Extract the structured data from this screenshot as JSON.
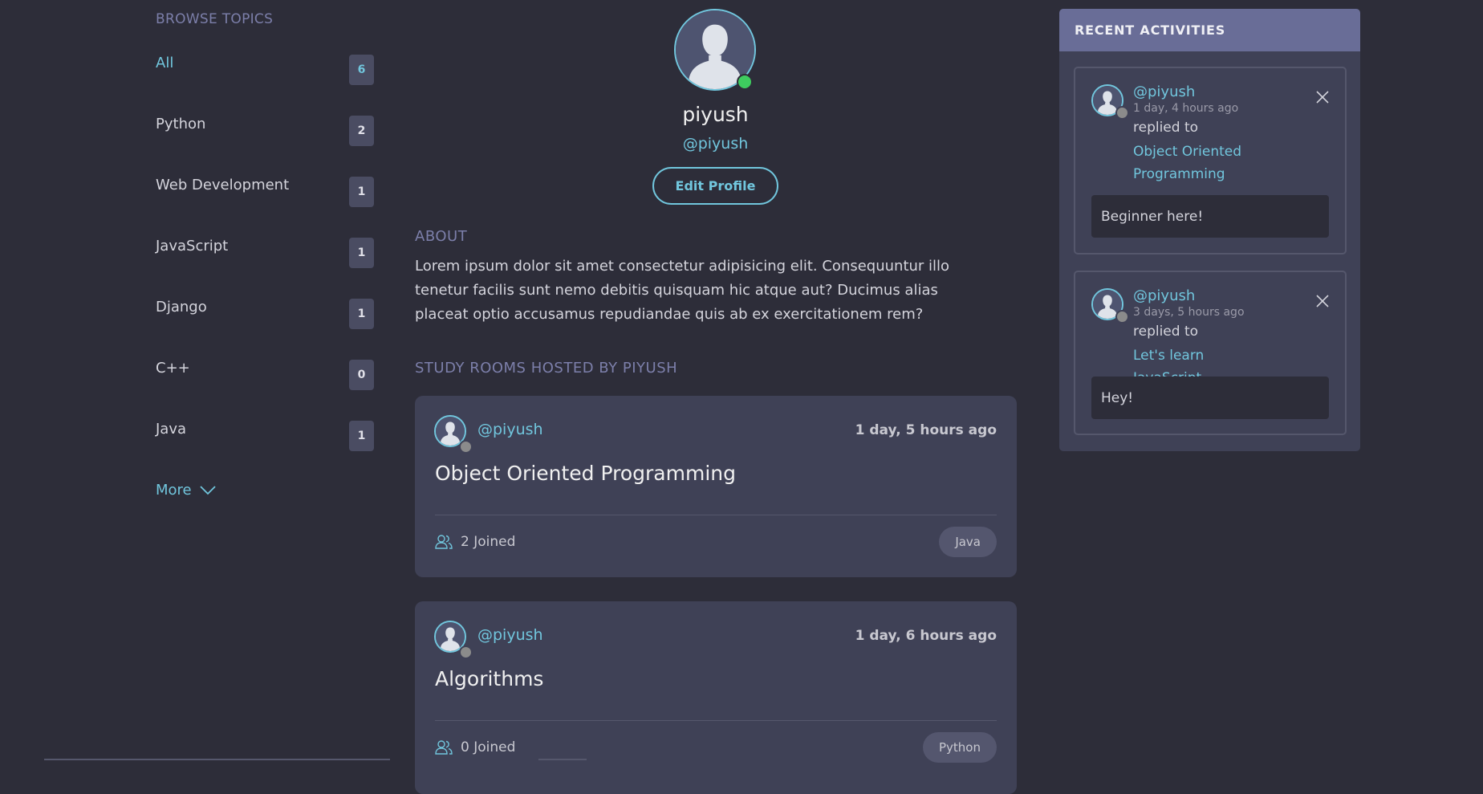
{
  "sidebar": {
    "title": "BROWSE TOPICS",
    "topics": [
      {
        "label": "All",
        "count": "6"
      },
      {
        "label": "Python",
        "count": "2"
      },
      {
        "label": "Web Development",
        "count": "1"
      },
      {
        "label": "JavaScript",
        "count": "1"
      },
      {
        "label": "Django",
        "count": "1"
      },
      {
        "label": "C++",
        "count": "0"
      },
      {
        "label": "Java",
        "count": "1"
      }
    ],
    "more_label": "More"
  },
  "profile": {
    "name": "piyush",
    "username": "@piyush",
    "edit_label": "Edit Profile",
    "about_title": "ABOUT",
    "about_text": "Lorem ipsum dolor sit amet consectetur adipisicing elit. Consequuntur illo tenetur facilis sunt nemo debitis quisquam hic atque aut? Ducimus alias placeat optio accusamus repudiandae quis ab ex exercitationem rem?",
    "rooms_title": "STUDY ROOMS HOSTED BY PIYUSH"
  },
  "rooms": [
    {
      "user": "@piyush",
      "time": "1 day, 5 hours ago",
      "title": "Object Oriented Programming",
      "joined": "2 Joined",
      "tag": "Java"
    },
    {
      "user": "@piyush",
      "time": "1 day, 6 hours ago",
      "title": "Algorithms",
      "joined": "0 Joined",
      "tag": "Python"
    }
  ],
  "activities": {
    "title": "RECENT ACTIVITIES",
    "items": [
      {
        "user": "@piyush",
        "time": "1 day, 4 hours ago",
        "verb": "replied to",
        "room": "Object Oriented Programming",
        "reply": "Beginner here!"
      },
      {
        "user": "@piyush",
        "time": "3 days, 5 hours ago",
        "verb": "replied to",
        "room": "Let's learn JavaScript",
        "reply": "Hey!"
      }
    ]
  },
  "colors": {
    "accent": "#71c6dd",
    "background": "#2d2d39",
    "card": "#3f4156",
    "header": "#696d97",
    "online": "#3ecc5f"
  }
}
